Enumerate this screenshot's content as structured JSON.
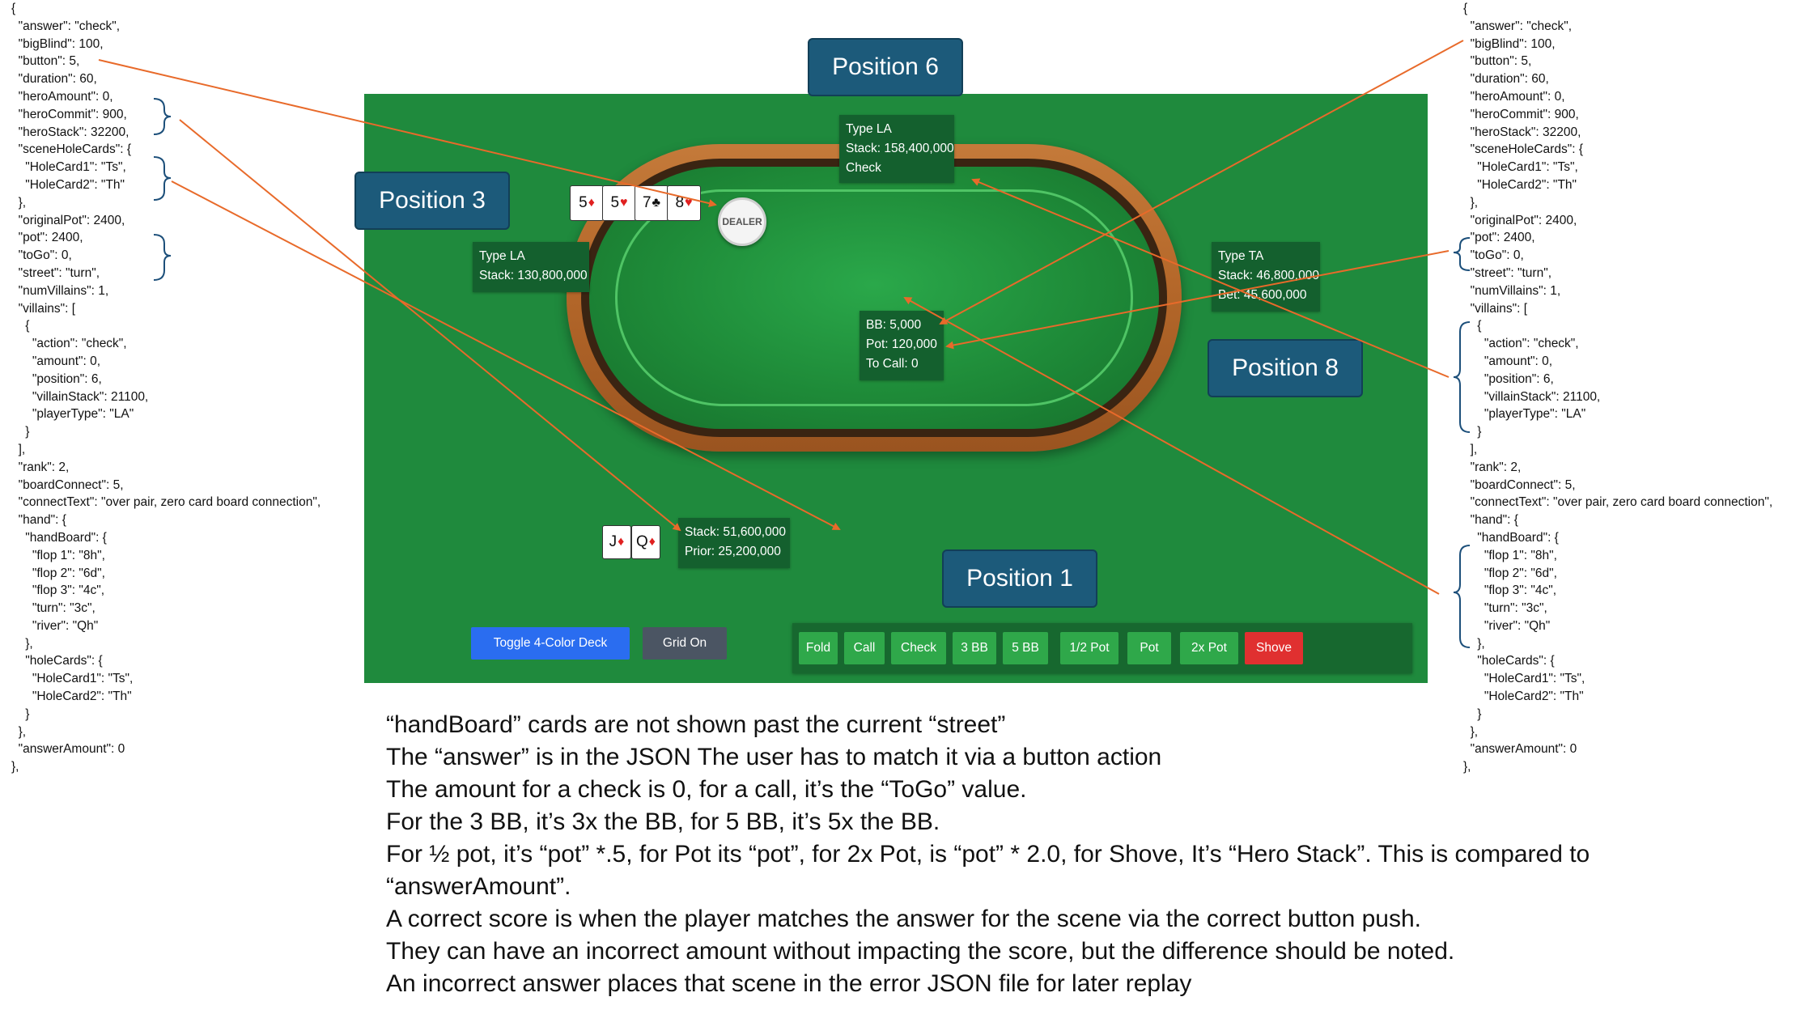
{
  "json_left": [
    "{",
    "  \"answer\": \"check\",",
    "  \"bigBlind\": 100,",
    "  \"button\": 5,",
    "  \"duration\": 60,",
    "  \"heroAmount\": 0,",
    "  \"heroCommit\": 900,",
    "  \"heroStack\": 32200,",
    "  \"sceneHoleCards\": {",
    "    \"HoleCard1\": \"Ts\",",
    "    \"HoleCard2\": \"Th\"",
    "  },",
    "  \"originalPot\": 2400,",
    "  \"pot\": 2400,",
    "  \"toGo\": 0,",
    "  \"street\": \"turn\",",
    "  \"numVillains\": 1,",
    "  \"villains\": [",
    "    {",
    "      \"action\": \"check\",",
    "      \"amount\": 0,",
    "      \"position\": 6,",
    "      \"villainStack\": 21100,",
    "      \"playerType\": \"LA\"",
    "    }",
    "  ],",
    "  \"rank\": 2,",
    "  \"boardConnect\": 5,",
    "  \"connectText\": \"over pair, zero card board connection\",",
    "  \"hand\": {",
    "    \"handBoard\": {",
    "      \"flop 1\": \"8h\",",
    "      \"flop 2\": \"6d\",",
    "      \"flop 3\": \"4c\",",
    "      \"turn\": \"3c\",",
    "      \"river\": \"Qh\"",
    "    },",
    "    \"holeCards\": {",
    "      \"HoleCard1\": \"Ts\",",
    "      \"HoleCard2\": \"Th\"",
    "    }",
    "  },",
    "  \"answerAmount\": 0",
    "},"
  ],
  "json_right": [
    "{",
    "  \"answer\": \"check\",",
    "  \"bigBlind\": 100,",
    "  \"button\": 5,",
    "  \"duration\": 60,",
    "  \"heroAmount\": 0,",
    "  \"heroCommit\": 900,",
    "  \"heroStack\": 32200,",
    "  \"sceneHoleCards\": {",
    "    \"HoleCard1\": \"Ts\",",
    "    \"HoleCard2\": \"Th\"",
    "  },",
    "  \"originalPot\": 2400,",
    "  \"pot\": 2400,",
    "  \"toGo\": 0,",
    "  \"street\": \"turn\",",
    "  \"numVillains\": 1,",
    "  \"villains\": [",
    "    {",
    "      \"action\": \"check\",",
    "      \"amount\": 0,",
    "      \"position\": 6,",
    "      \"villainStack\": 21100,",
    "      \"playerType\": \"LA\"",
    "    }",
    "  ],",
    "  \"rank\": 2,",
    "  \"boardConnect\": 5,",
    "  \"connectText\": \"over pair, zero card board connection\",",
    "  \"hand\": {",
    "    \"handBoard\": {",
    "      \"flop 1\": \"8h\",",
    "      \"flop 2\": \"6d\",",
    "      \"flop 3\": \"4c\",",
    "      \"turn\": \"3c\",",
    "      \"river\": \"Qh\"",
    "    },",
    "    \"holeCards\": {",
    "      \"HoleCard1\": \"Ts\",",
    "      \"HoleCard2\": \"Th\"",
    "    }",
    "  },",
    "  \"answerAmount\": 0",
    "},"
  ],
  "positions": {
    "p6": "Position 6",
    "p3": "Position 3",
    "p8": "Position 8",
    "p1": "Position 1"
  },
  "seats": {
    "pos6": {
      "type": "Type LA",
      "stack": "Stack: 158,400,000",
      "action": "Check"
    },
    "pos3": {
      "type": "Type LA",
      "stack": "Stack: 130,800,000"
    },
    "pos8": {
      "type": "Type TA",
      "stack": "Stack: 46,800,000",
      "bet": "Bet: 45,600,000"
    },
    "hero": {
      "stack": "Stack: 51,600,000",
      "prior": "Prior: 25,200,000"
    }
  },
  "dealer_label": "DEALER",
  "board_cards": [
    {
      "rank": "5",
      "suit": "♦",
      "color": "#e02020"
    },
    {
      "rank": "5",
      "suit": "♥",
      "color": "#e02020"
    },
    {
      "rank": "7",
      "suit": "♣",
      "color": "#111111"
    },
    {
      "rank": "8",
      "suit": "♥",
      "color": "#e02020"
    }
  ],
  "hero_cards": [
    {
      "rank": "J",
      "suit": "♦",
      "color": "#e02020"
    },
    {
      "rank": "Q",
      "suit": "♦",
      "color": "#e02020"
    }
  ],
  "pot_info": {
    "bb": "BB: 5,000",
    "pot": "Pot: 120,000",
    "to_call": "To Call: 0"
  },
  "controls": {
    "toggle_deck": "Toggle 4-Color Deck",
    "grid": "Grid On"
  },
  "actions": [
    "Fold",
    "Call",
    "Check",
    "3 BB",
    "5 BB",
    "1/2 Pot",
    "Pot",
    "2x Pot",
    "Shove"
  ],
  "colors": {
    "table_green": "#1f8a3d",
    "action_green": "#2fa84a",
    "shove_red": "#e03030",
    "toggle_blue": "#2a6df0",
    "grid_gray": "#4b5563",
    "position_label": "#1c5a7a",
    "arrow": "#e86a2a"
  },
  "notes": [
    "“handBoard” cards are not shown past the current “street”",
    "The “answer” is in the JSON The user has to match it via a button action",
    "The amount for a check is 0, for a call, it’s the “ToGo” value.",
    "For the 3 BB, it’s 3x the BB, for 5 BB, it’s 5x the BB.",
    "For ½ pot, it’s “pot” *.5, for Pot its “pot”, for 2x Pot, is “pot” * 2.0, for Shove, It’s “Hero Stack”. This is compared to",
    "“answerAmount”.",
    "A correct score is when the player matches the answer for the scene via the correct button push.",
    "They can have an incorrect amount without impacting the score, but the difference should be noted.",
    "An incorrect answer places that scene in the error JSON file for later replay"
  ]
}
